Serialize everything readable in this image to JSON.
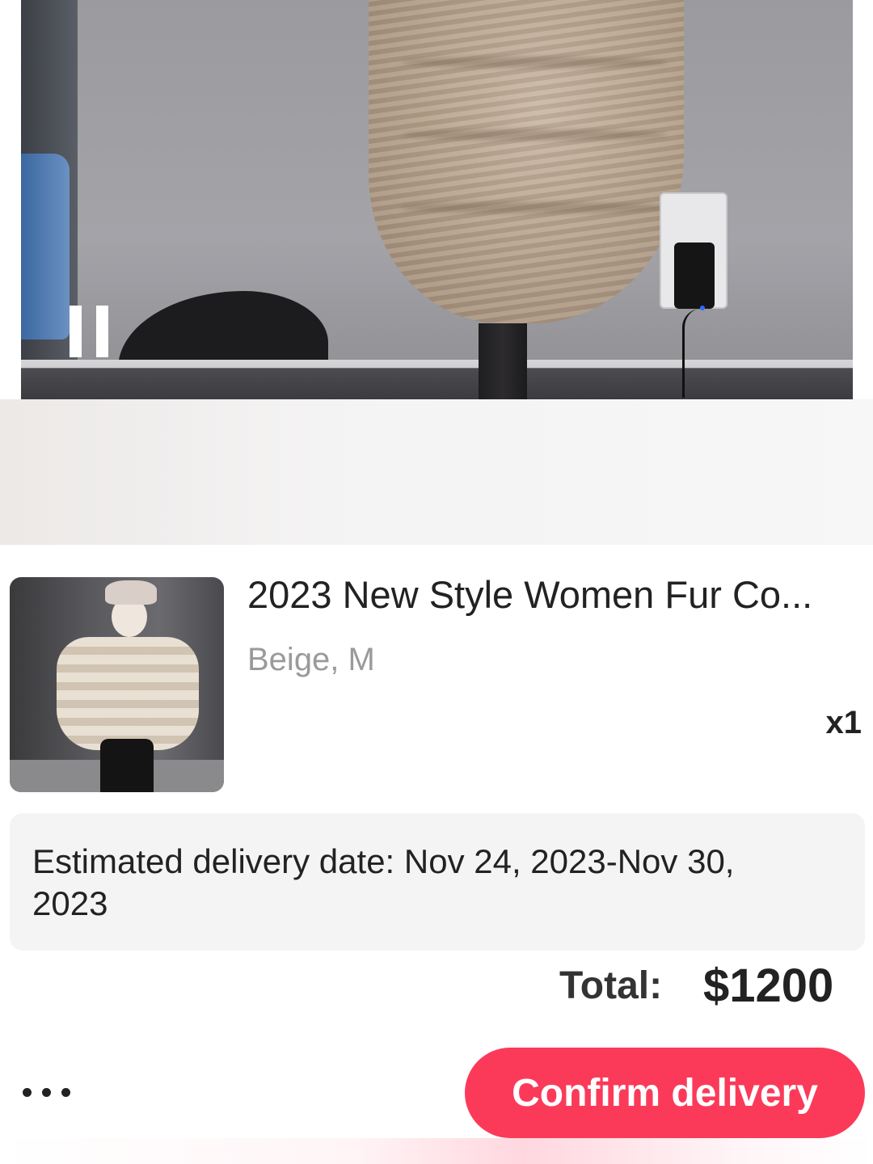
{
  "video": {
    "state": "playing",
    "control_icon": "pause-icon"
  },
  "product": {
    "title": "2023 New Style Women Fur Co...",
    "variant": "Beige, M",
    "quantity": "x1"
  },
  "delivery": {
    "text": "Estimated delivery date: Nov 24, 2023-Nov 30, 2023"
  },
  "order": {
    "total_label": "Total:",
    "total_value": "$1200"
  },
  "actions": {
    "more_icon": "more-dots-icon",
    "confirm_label": "Confirm delivery"
  },
  "colors": {
    "accent": "#fb3a5a",
    "text_primary": "#222222",
    "text_secondary": "#9a9a9a",
    "card_bg": "#f4f4f4"
  }
}
